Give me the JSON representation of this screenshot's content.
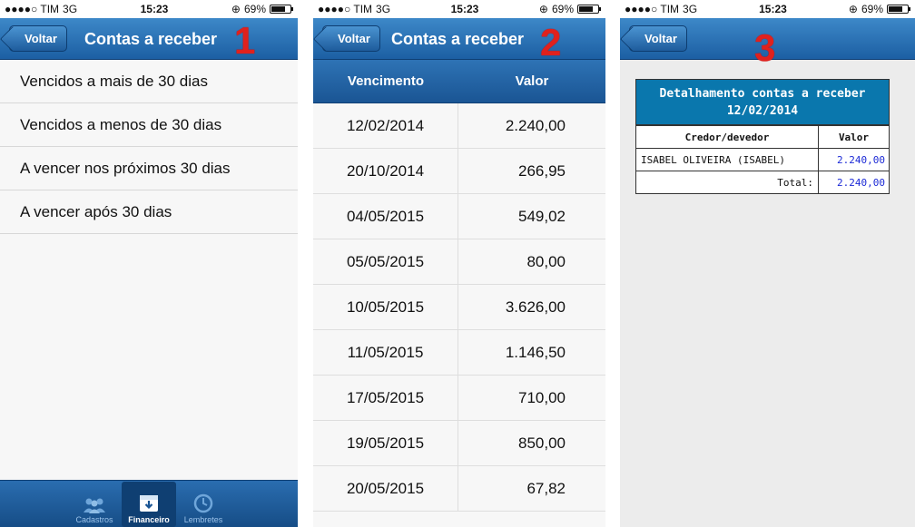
{
  "status": {
    "carrier": "●●●●○ TIM",
    "network": "3G",
    "time": "15:23",
    "battery": "69%",
    "battery_level": 0.69
  },
  "screen1": {
    "back": "Voltar",
    "title": "Contas a receber",
    "number": "1",
    "items": [
      "Vencidos a mais de 30 dias",
      "Vencidos a menos de 30 dias",
      "A vencer nos próximos 30 dias",
      "A vencer após 30 dias"
    ],
    "tabs": [
      {
        "label": "Cadastros",
        "icon": "people-icon"
      },
      {
        "label": "Financeiro",
        "icon": "download-box-icon"
      },
      {
        "label": "Lembretes",
        "icon": "clock-icon"
      }
    ]
  },
  "screen2": {
    "back": "Voltar",
    "title": "Contas a receber",
    "number": "2",
    "columns": [
      "Vencimento",
      "Valor"
    ],
    "rows": [
      {
        "date": "12/02/2014",
        "value": "2.240,00"
      },
      {
        "date": "20/10/2014",
        "value": "266,95"
      },
      {
        "date": "04/05/2015",
        "value": "549,02"
      },
      {
        "date": "05/05/2015",
        "value": "80,00"
      },
      {
        "date": "10/05/2015",
        "value": "3.626,00"
      },
      {
        "date": "11/05/2015",
        "value": "1.146,50"
      },
      {
        "date": "17/05/2015",
        "value": "710,00"
      },
      {
        "date": "19/05/2015",
        "value": "850,00"
      },
      {
        "date": "20/05/2015",
        "value": "67,82"
      }
    ]
  },
  "screen3": {
    "back": "Voltar",
    "number": "3",
    "detail_title": "Detalhamento contas a receber",
    "detail_date": "12/02/2014",
    "col1": "Credor/devedor",
    "col2": "Valor",
    "row_name": "ISABEL OLIVEIRA (ISABEL)",
    "row_value": "2.240,00",
    "total_label": "Total:",
    "total_value": "2.240,00"
  }
}
